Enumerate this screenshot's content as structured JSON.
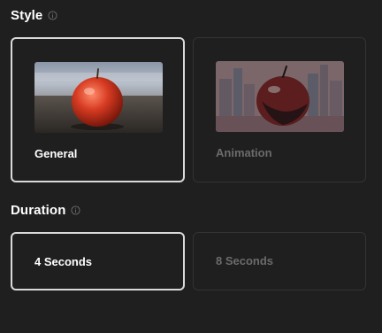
{
  "style": {
    "title": "Style",
    "info_icon": "info-icon",
    "options": [
      {
        "label": "General",
        "selected": true,
        "thumbnail": "realistic-apple-on-field"
      },
      {
        "label": "Animation",
        "selected": false,
        "thumbnail": "stylized-apple-city-skyline"
      }
    ]
  },
  "duration": {
    "title": "Duration",
    "info_icon": "info-icon",
    "options": [
      {
        "label": "4 Seconds",
        "selected": true
      },
      {
        "label": "8 Seconds",
        "selected": false
      }
    ]
  },
  "colors": {
    "background": "#1f1f1f",
    "selected_border": "#d9d9d9",
    "unselected_border": "#333333",
    "muted_text": "#6b6b6b"
  }
}
